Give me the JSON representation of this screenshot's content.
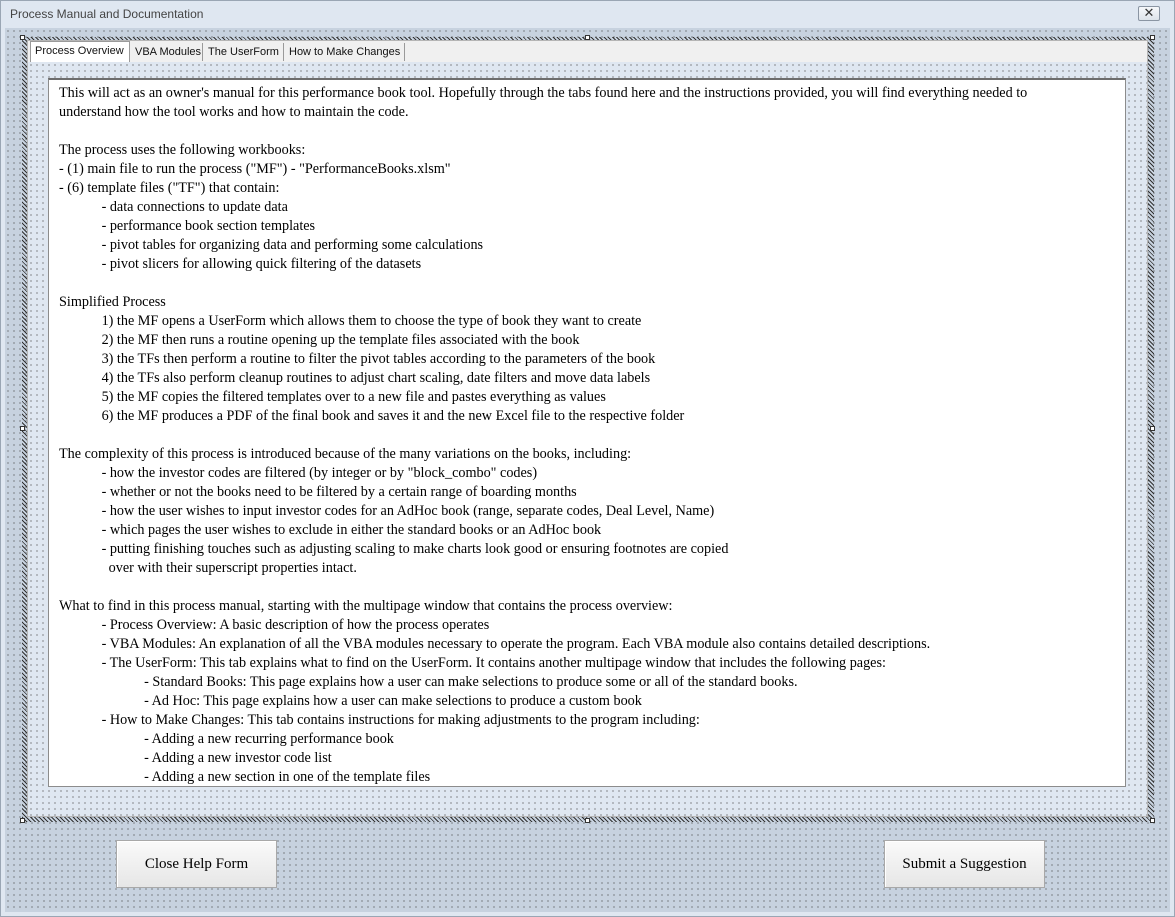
{
  "window": {
    "title": "Process Manual and Documentation",
    "close_glyph": "✕"
  },
  "tabs": [
    {
      "label": "Process Overview",
      "active": true
    },
    {
      "label": "VBA Modules",
      "active": false
    },
    {
      "label": "The UserForm",
      "active": false
    },
    {
      "label": "How to Make Changes",
      "active": false
    }
  ],
  "document": {
    "lines": [
      "This will act as an owner's manual for this performance book tool. Hopefully through the tabs found here and the instructions provided, you will find everything needed to",
      "understand how the tool works and how to maintain the code.",
      "",
      "The process uses the following workbooks:",
      "- (1) main file to run the process (\"MF\") - \"PerformanceBooks.xlsm\"",
      "- (6) template files (\"TF\") that contain:",
      "            - data connections to update data",
      "            - performance book section templates",
      "            - pivot tables for organizing data and performing some calculations",
      "            - pivot slicers for allowing quick filtering of the datasets",
      "",
      "Simplified Process",
      "            1) the MF opens a UserForm which allows them to choose the type of book they want to create",
      "            2) the MF then runs a routine opening up the template files associated with the book",
      "            3) the TFs then perform a routine to filter the pivot tables according to the parameters of the book",
      "            4) the TFs also perform cleanup routines to adjust chart scaling, date filters and move data labels",
      "            5) the MF copies the filtered templates over to a new file and pastes everything as values",
      "            6) the MF produces a PDF of the final book and saves it and the new Excel file to the respective folder",
      "",
      "The complexity of this process is introduced because of the many variations on the books, including:",
      "            - how the investor codes are filtered (by integer or by \"block_combo\" codes)",
      "            - whether or not the books need to be filtered by a certain range of boarding months",
      "            - how the user wishes to input investor codes for an AdHoc book (range, separate codes, Deal Level, Name)",
      "            - which pages the user wishes to exclude in either the standard books or an AdHoc book",
      "            - putting finishing touches such as adjusting scaling to make charts look good or ensuring footnotes are copied",
      "              over with their superscript properties intact.",
      "",
      "What to find in this process manual, starting with the multipage window that contains the process overview:",
      "            - Process Overview: A basic description of how the process operates",
      "            - VBA Modules: An explanation of all the VBA modules necessary to operate the program. Each VBA module also contains detailed descriptions.",
      "            - The UserForm: This tab explains what to find on the UserForm. It contains another multipage window that includes the following pages:",
      "                        - Standard Books: This page explains how a user can make selections to produce some or all of the standard books.",
      "                        - Ad Hoc: This page explains how a user can make selections to produce a custom book",
      "            - How to Make Changes: This tab contains instructions for making adjustments to the program including:",
      "                        - Adding a new recurring performance book",
      "                        - Adding a new investor code list",
      "                        - Adding a new section in one of the template files"
    ]
  },
  "buttons": {
    "close": "Close Help Form",
    "suggest": "Submit a Suggestion"
  }
}
